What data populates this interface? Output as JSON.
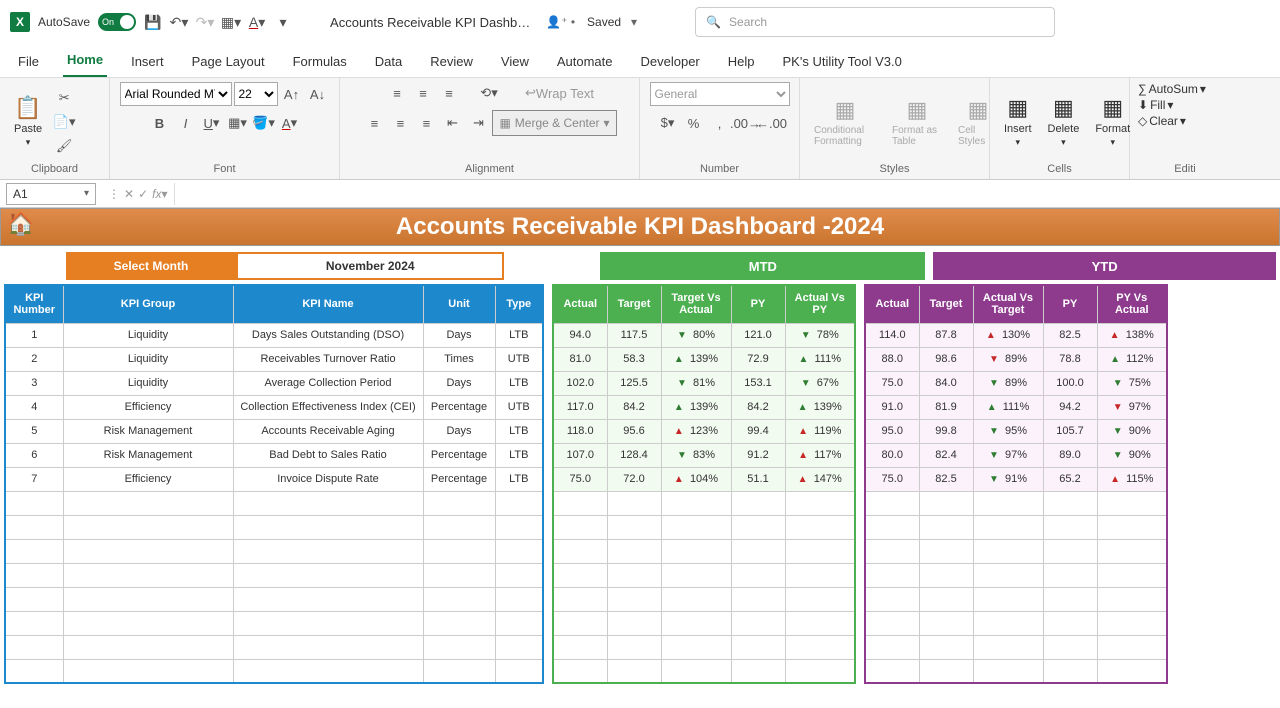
{
  "titlebar": {
    "autosave": "AutoSave",
    "autosave_state": "On",
    "doc_title": "Accounts Receivable KPI Dashb…",
    "saved": "Saved",
    "search_placeholder": "Search"
  },
  "tabs": [
    "File",
    "Home",
    "Insert",
    "Page Layout",
    "Formulas",
    "Data",
    "Review",
    "View",
    "Automate",
    "Developer",
    "Help",
    "PK's Utility Tool V3.0"
  ],
  "active_tab": "Home",
  "ribbon": {
    "font_name": "Arial Rounded MT",
    "font_size": "22",
    "number_format": "General",
    "merge_label": "Merge & Center",
    "wrap_label": "Wrap Text",
    "groups": {
      "clipboard": "Clipboard",
      "font": "Font",
      "alignment": "Alignment",
      "number": "Number",
      "styles": "Styles",
      "cells": "Cells",
      "editing": "Editi"
    },
    "paste": "Paste",
    "cond_fmt": "Conditional Formatting",
    "fmt_table": "Format as Table",
    "cell_styles": "Cell Styles",
    "insert": "Insert",
    "delete": "Delete",
    "format": "Format",
    "autosum": "AutoSum",
    "fill": "Fill",
    "clear": "Clear"
  },
  "namebox": "A1",
  "dashboard": {
    "title": "Accounts Receivable KPI Dashboard  -2024",
    "select_month_label": "Select Month",
    "select_month_value": "November 2024",
    "mtd_label": "MTD",
    "ytd_label": "YTD",
    "left_headers": [
      "KPI Number",
      "KPI Group",
      "KPI Name",
      "Unit",
      "Type"
    ],
    "mtd_headers": [
      "Actual",
      "Target",
      "Target Vs Actual",
      "PY",
      "Actual Vs PY"
    ],
    "ytd_headers": [
      "Actual",
      "Target",
      "Actual Vs Target",
      "PY",
      "PY Vs Actual"
    ],
    "rows": [
      {
        "num": "1",
        "group": "Liquidity",
        "name": "Days Sales Outstanding (DSO)",
        "unit": "Days",
        "type": "LTB",
        "mtd": {
          "a": "94.0",
          "t": "117.5",
          "tva": "80%",
          "tva_dir": "dn",
          "py": "121.0",
          "avp": "78%",
          "avp_dir": "dn"
        },
        "ytd": {
          "a": "114.0",
          "t": "87.8",
          "avt": "130%",
          "avt_dir": "up-bad",
          "py": "82.5",
          "pya": "138%",
          "pya_dir": "up-bad"
        }
      },
      {
        "num": "2",
        "group": "Liquidity",
        "name": "Receivables Turnover Ratio",
        "unit": "Times",
        "type": "UTB",
        "mtd": {
          "a": "81.0",
          "t": "58.3",
          "tva": "139%",
          "tva_dir": "up",
          "py": "72.9",
          "avp": "111%",
          "avp_dir": "up"
        },
        "ytd": {
          "a": "88.0",
          "t": "98.6",
          "avt": "89%",
          "avt_dir": "dn-bad",
          "py": "78.8",
          "pya": "112%",
          "pya_dir": "up"
        }
      },
      {
        "num": "3",
        "group": "Liquidity",
        "name": "Average Collection Period",
        "unit": "Days",
        "type": "LTB",
        "mtd": {
          "a": "102.0",
          "t": "125.5",
          "tva": "81%",
          "tva_dir": "dn",
          "py": "153.1",
          "avp": "67%",
          "avp_dir": "dn"
        },
        "ytd": {
          "a": "75.0",
          "t": "84.0",
          "avt": "89%",
          "avt_dir": "dn",
          "py": "100.0",
          "pya": "75%",
          "pya_dir": "dn"
        }
      },
      {
        "num": "4",
        "group": "Efficiency",
        "name": "Collection Effectiveness Index (CEI)",
        "unit": "Percentage",
        "type": "UTB",
        "mtd": {
          "a": "117.0",
          "t": "84.2",
          "tva": "139%",
          "tva_dir": "up",
          "py": "84.2",
          "avp": "139%",
          "avp_dir": "up"
        },
        "ytd": {
          "a": "91.0",
          "t": "81.9",
          "avt": "111%",
          "avt_dir": "up",
          "py": "94.2",
          "pya": "97%",
          "pya_dir": "dn-bad"
        }
      },
      {
        "num": "5",
        "group": "Risk Management",
        "name": "Accounts Receivable Aging",
        "unit": "Days",
        "type": "LTB",
        "mtd": {
          "a": "118.0",
          "t": "95.6",
          "tva": "123%",
          "tva_dir": "up-bad",
          "py": "99.4",
          "avp": "119%",
          "avp_dir": "up-bad"
        },
        "ytd": {
          "a": "95.0",
          "t": "99.8",
          "avt": "95%",
          "avt_dir": "dn",
          "py": "105.7",
          "pya": "90%",
          "pya_dir": "dn"
        }
      },
      {
        "num": "6",
        "group": "Risk Management",
        "name": "Bad Debt to Sales Ratio",
        "unit": "Percentage",
        "type": "LTB",
        "mtd": {
          "a": "107.0",
          "t": "128.4",
          "tva": "83%",
          "tva_dir": "dn",
          "py": "91.2",
          "avp": "117%",
          "avp_dir": "up-bad"
        },
        "ytd": {
          "a": "80.0",
          "t": "82.4",
          "avt": "97%",
          "avt_dir": "dn",
          "py": "89.0",
          "pya": "90%",
          "pya_dir": "dn"
        }
      },
      {
        "num": "7",
        "group": "Efficiency",
        "name": "Invoice Dispute Rate",
        "unit": "Percentage",
        "type": "LTB",
        "mtd": {
          "a": "75.0",
          "t": "72.0",
          "tva": "104%",
          "tva_dir": "up-bad",
          "py": "51.1",
          "avp": "147%",
          "avp_dir": "up-bad"
        },
        "ytd": {
          "a": "75.0",
          "t": "82.5",
          "avt": "91%",
          "avt_dir": "dn",
          "py": "65.2",
          "pya": "115%",
          "pya_dir": "up-bad"
        }
      }
    ]
  }
}
